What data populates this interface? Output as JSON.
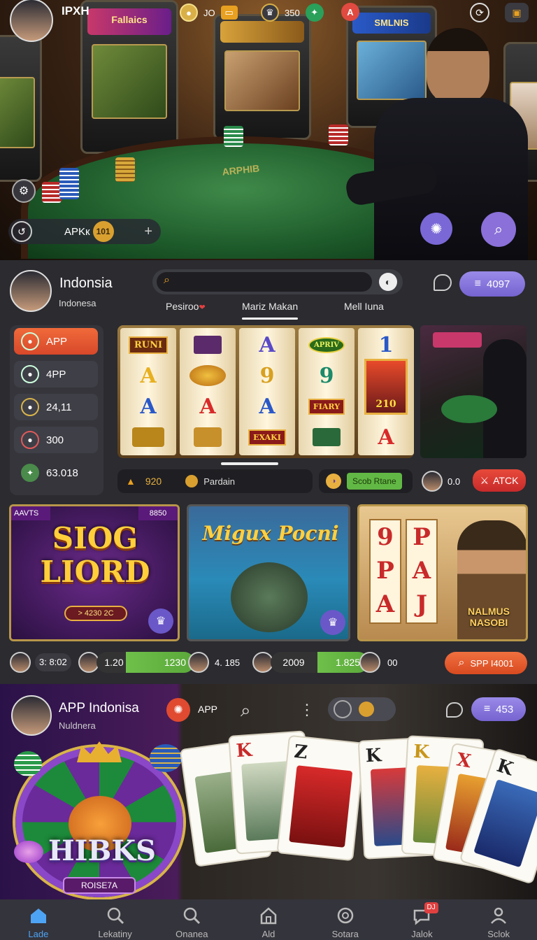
{
  "colors": {
    "accent_orange": "#e05a30",
    "accent_purple": "#7a68d6",
    "accent_green": "#62b844",
    "nav_active": "#4ea4f4",
    "gold": "#d9b048"
  },
  "hero": {
    "username": "IPXH",
    "left_machine_text": "Fallaics",
    "right_machine_text": "SMLNIS",
    "table_text": "ARPHIB",
    "stats": [
      {
        "icon": "coin-icon",
        "value": "JO"
      },
      {
        "icon": "crown-icon",
        "value": "350"
      }
    ],
    "apk_label": "APKк",
    "apk_badge": "101"
  },
  "profile": {
    "name": "Indonsia",
    "subtitle": "Indonesa",
    "balance": "4097"
  },
  "search": {
    "placeholder": ""
  },
  "tabs": [
    {
      "label": "Pesiroo"
    },
    {
      "label": "Mariz Makan"
    },
    {
      "label": "Mell Iuna"
    }
  ],
  "sidebar": {
    "items": [
      {
        "label": "APP"
      },
      {
        "label": "4PP"
      },
      {
        "label": "24,11"
      },
      {
        "label": "300"
      },
      {
        "label": "63.018"
      }
    ]
  },
  "slot": {
    "reels": [
      [
        "RUNI",
        "",
        "A",
        "A",
        ""
      ],
      [
        "",
        "",
        "",
        "A",
        ""
      ],
      [
        "A",
        "9",
        "A",
        "EXAKI",
        ""
      ],
      [
        "APRIV",
        "9",
        "FIARY",
        ""
      ],
      [
        "1",
        "210",
        "A"
      ]
    ],
    "bonus_value": "920",
    "bonus_label": "Pardain",
    "scroll_label": "Scob Rtane",
    "player_value": "0.0",
    "attack_label": "ATCK"
  },
  "games": [
    {
      "title": "SIOG LIORD",
      "tag": "AAVTS",
      "tag_right": "8850",
      "sub": "> 4230 2C"
    },
    {
      "title": "Migux Pocni"
    },
    {
      "title": "NALMUS NASOBI"
    }
  ],
  "game_stats": [
    {
      "value": "3: 8:02"
    },
    {
      "value": "1.20",
      "pill": "1230"
    },
    {
      "value": "4. 185"
    },
    {
      "value": "2009",
      "pill": "1.825"
    },
    {
      "value": "00"
    }
  ],
  "spin_button": "SPP I4001",
  "bottom": {
    "title": "APP Indonisa",
    "subtitle": "Nuldnera",
    "app_label": "APP",
    "balance": "453",
    "wheel_title": "HIBKS",
    "wheel_sub": "ROISE7A",
    "cards": [
      "K",
      "Z",
      "K",
      "K",
      "X",
      "K"
    ]
  },
  "nav": [
    {
      "label": "Lade",
      "icon": "home-icon"
    },
    {
      "label": "Lekatiny",
      "icon": "search-icon"
    },
    {
      "label": "Onanea",
      "icon": "search-icon"
    },
    {
      "label": "Ald",
      "icon": "house-icon"
    },
    {
      "label": "Sotara",
      "icon": "target-icon"
    },
    {
      "label": "Jalok",
      "icon": "chat-icon",
      "badge": "DJ"
    },
    {
      "label": "Sclok",
      "icon": "user-icon"
    }
  ]
}
